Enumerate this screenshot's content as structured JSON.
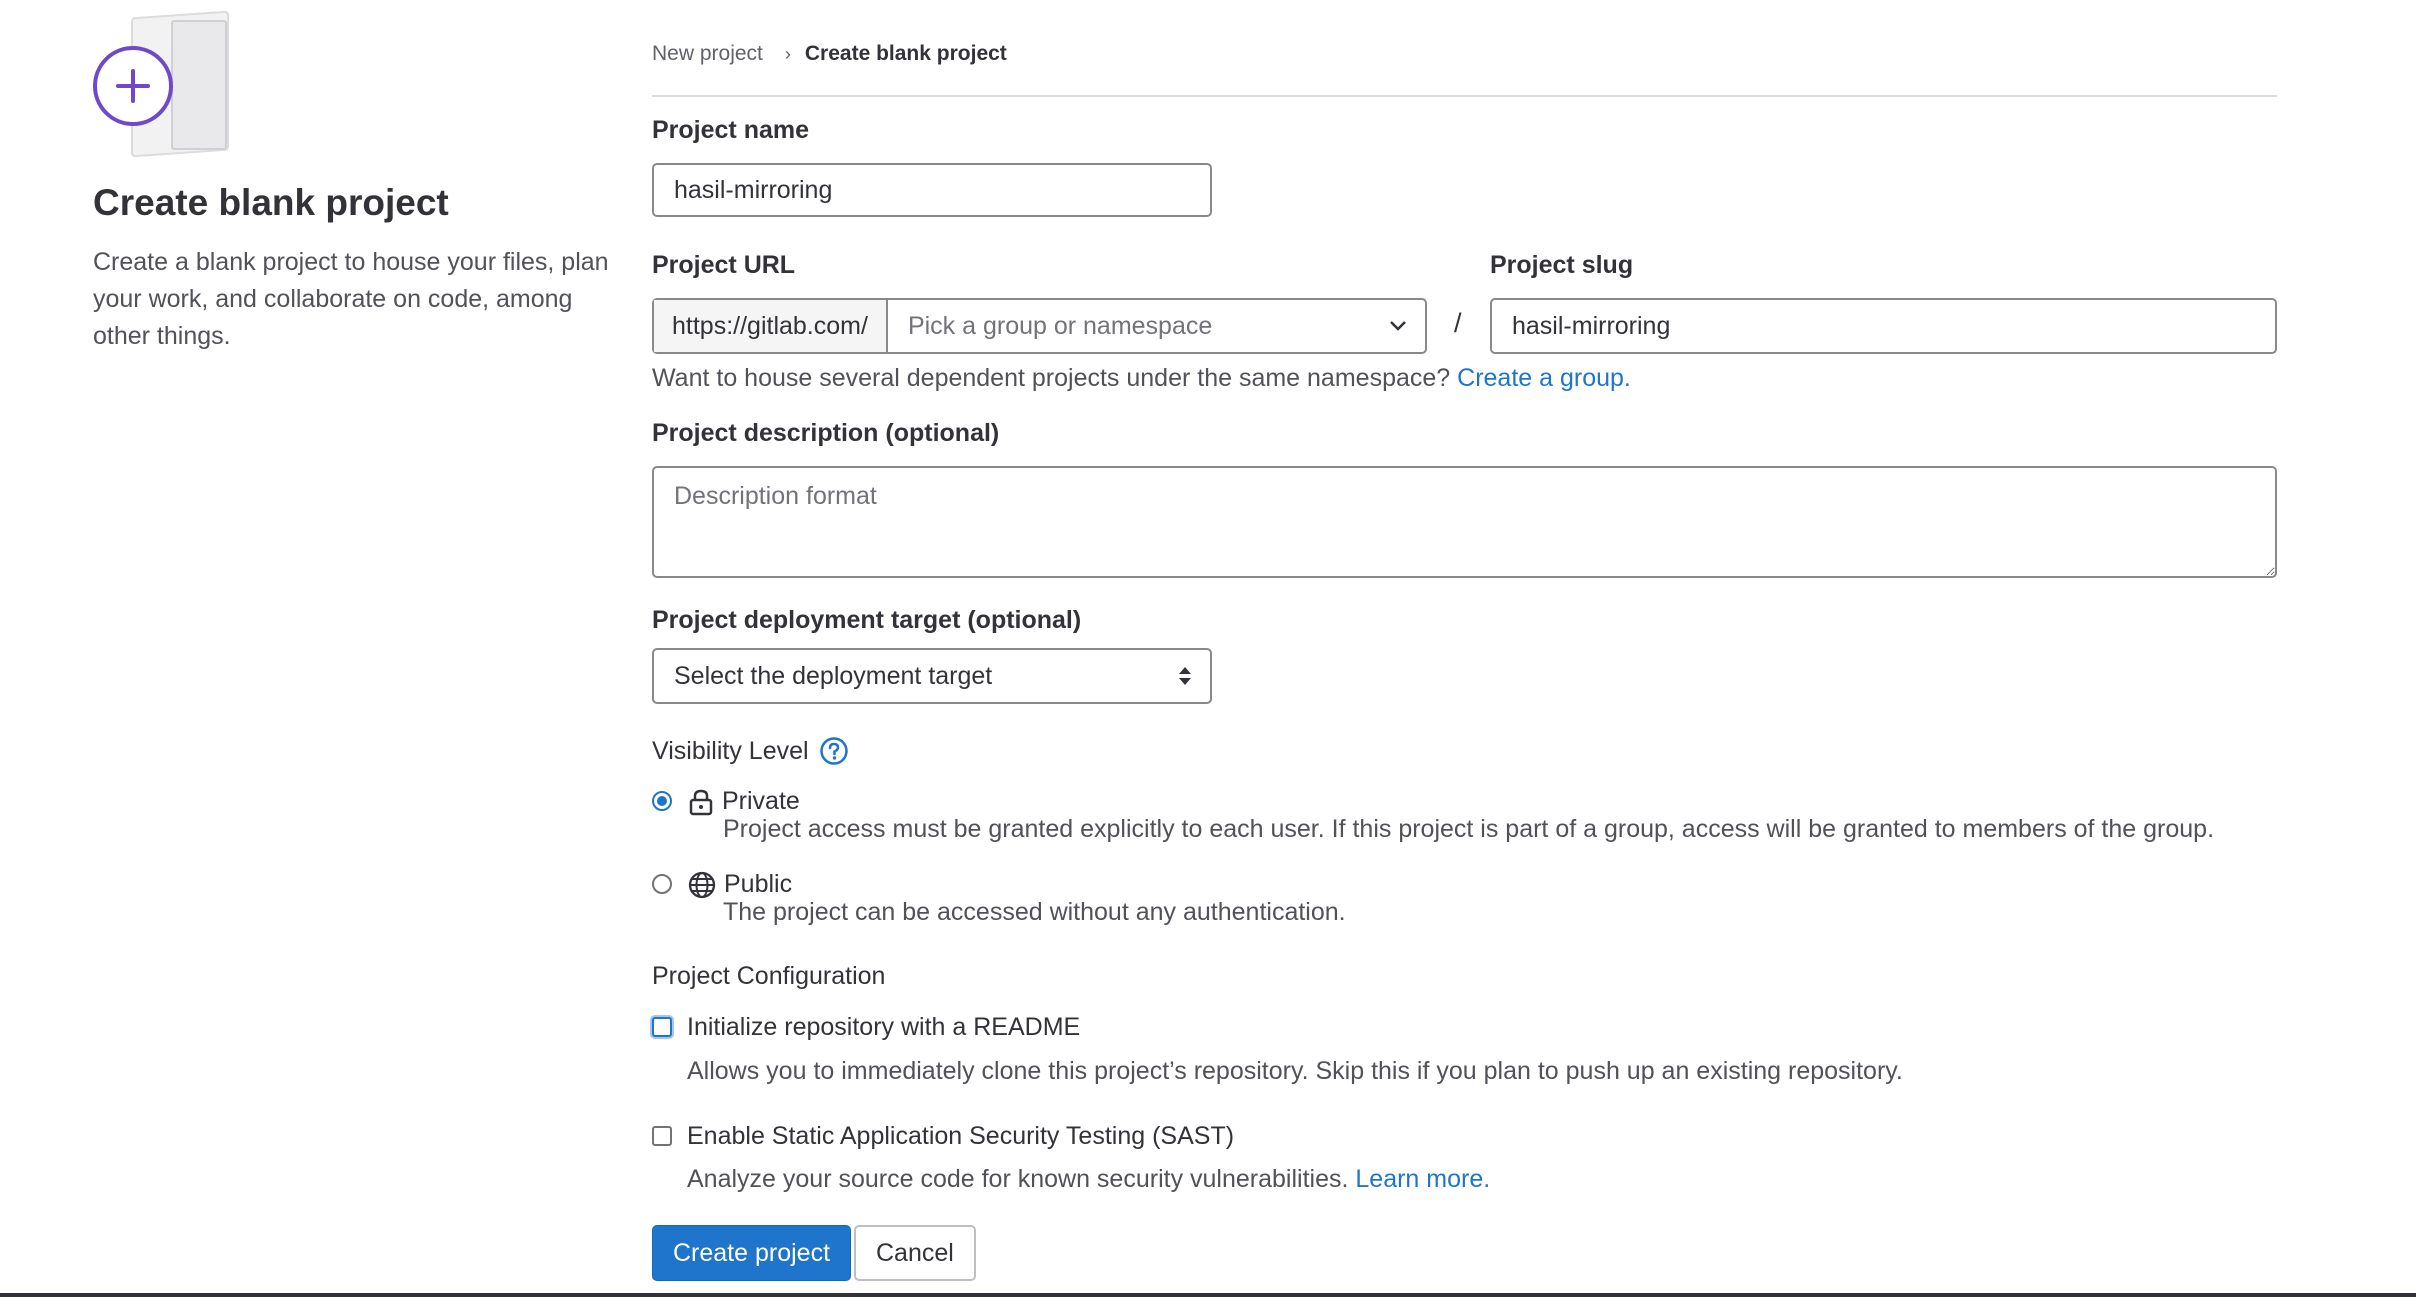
{
  "sidebar": {
    "title": "Create blank project",
    "description": "Create a blank project to house your files, plan your work, and collaborate on code, among other things."
  },
  "breadcrumb": {
    "parent": "New project",
    "current": "Create blank project"
  },
  "form": {
    "project_name_label": "Project name",
    "project_name_value": "hasil-mirroring",
    "project_url_label": "Project URL",
    "url_prefix": "https://gitlab.com/",
    "namespace_placeholder": "Pick a group or namespace",
    "slash": "/",
    "project_slug_label": "Project slug",
    "project_slug_value": "hasil-mirroring",
    "namespace_help": "Want to house several dependent projects under the same namespace?",
    "create_group_link": "Create a group.",
    "description_label": "Project description (optional)",
    "description_placeholder": "Description format",
    "deployment_label": "Project deployment target (optional)",
    "deployment_value": "Select the deployment target",
    "visibility_label": "Visibility Level",
    "visibility_options": [
      {
        "title": "Private",
        "description": "Project access must be granted explicitly to each user. If this project is part of a group, access will be granted to members of the group.",
        "selected": true
      },
      {
        "title": "Public",
        "description": "The project can be accessed without any authentication.",
        "selected": false
      }
    ],
    "config_label": "Project Configuration",
    "readme_title": "Initialize repository with a README",
    "readme_desc": "Allows you to immediately clone this project’s repository. Skip this if you plan to push up an existing repository.",
    "sast_title": "Enable Static Application Security Testing (SAST)",
    "sast_desc": "Analyze your source code for known security vulnerabilities.",
    "learn_more": "Learn more.",
    "create_button": "Create project",
    "cancel_button": "Cancel"
  },
  "colors": {
    "accent": "#1f75cb",
    "illustration_purple": "#6e49cb"
  }
}
